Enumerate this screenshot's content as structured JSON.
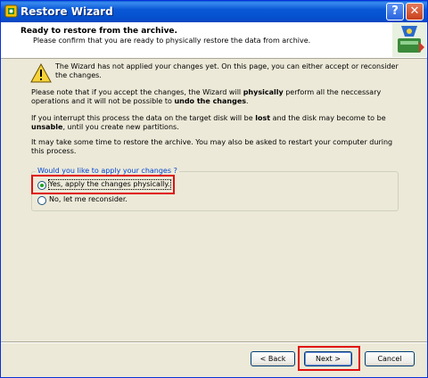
{
  "window": {
    "title": "Restore Wizard"
  },
  "header": {
    "title": "Ready to restore from the archive.",
    "subtitle": "Please confirm that you are ready to physically restore the data from archive."
  },
  "body": {
    "warning": "The Wizard has not applied your changes yet. On this page, you can either accept or reconsider the changes.",
    "para1": {
      "a": "Please note that if you accept the changes, the Wizard will ",
      "b": "physically",
      "c": " perform all the neccessary operations and it will not be possible to ",
      "d": "undo the changes",
      "e": "."
    },
    "para2": {
      "a": "If you interrupt this process the data on the target disk will be ",
      "b": "lost",
      "c": " and the disk may become to be ",
      "d": "unsable",
      "e": ", until you create new partitions."
    },
    "para3": "It may take some time to restore the archive. You may also be asked to restart your computer during this process."
  },
  "group": {
    "legend": "Would you like to apply your changes ?",
    "options": [
      {
        "label": "Yes, apply the changes physically.",
        "checked": true
      },
      {
        "label": "No, let me reconsider.",
        "checked": false
      }
    ]
  },
  "buttons": {
    "back": "< Back",
    "next": "Next >",
    "cancel": "Cancel"
  },
  "colors": {
    "titlebar": "#0a58d6",
    "highlight": "#e01010",
    "legend": "#0046d5"
  },
  "icons": {
    "app": "app-icon",
    "wizard": "wizard-graphic",
    "warning": "warning-icon"
  }
}
